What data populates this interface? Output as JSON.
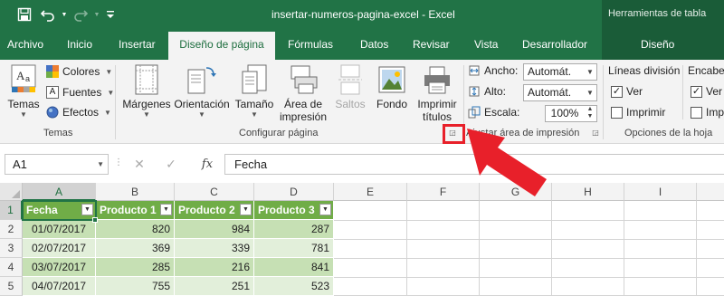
{
  "titlebar": {
    "document_title": "insertar-numeros-pagina-excel  -  Excel",
    "context_tools_label": "Herramientas de tabla"
  },
  "qat": {
    "save_icon": "save-icon",
    "undo_icon": "undo-icon",
    "redo_icon": "redo-icon",
    "customize_icon": "customize-qat-icon"
  },
  "tabs": {
    "archivo": "Archivo",
    "inicio": "Inicio",
    "insertar": "Insertar",
    "diseno_pagina": "Diseño de página",
    "formulas": "Fórmulas",
    "datos": "Datos",
    "revisar": "Revisar",
    "vista": "Vista",
    "desarrollador": "Desarrollador",
    "diseno": "Diseño"
  },
  "ribbon": {
    "temas": {
      "temas_label": "Temas",
      "colores_label": "Colores",
      "fuentes_label": "Fuentes",
      "efectos_label": "Efectos",
      "group_label": "Temas"
    },
    "configurar": {
      "margenes": "Márgenes",
      "orientacion": "Orientación",
      "tamano": "Tamaño",
      "area_impresion_1": "Área de",
      "area_impresion_2": "impresión",
      "saltos": "Saltos",
      "fondo": "Fondo",
      "imprimir_titulos_1": "Imprimir",
      "imprimir_titulos_2": "títulos",
      "group_label": "Configurar página"
    },
    "ajustar": {
      "ancho_label": "Ancho:",
      "ancho_value": "Automát.",
      "alto_label": "Alto:",
      "alto_value": "Automát.",
      "escala_label": "Escala:",
      "escala_value": "100%",
      "group_label": "Ajustar área de impresión"
    },
    "opciones": {
      "lineas_label": "Líneas división",
      "ver_label": "Ver",
      "imprimir_label": "Imprimir",
      "encabezados_label": "Encabeza",
      "ver2_label": "Ver",
      "imprimir2_label": "Imp",
      "group_label": "Opciones de la hoja"
    }
  },
  "formula_bar": {
    "name_box": "A1",
    "cancel_glyph": "✕",
    "enter_glyph": "✓",
    "fx_label": "fx",
    "formula": "Fecha"
  },
  "grid": {
    "columns": [
      "A",
      "B",
      "C",
      "D",
      "E",
      "F",
      "G",
      "H",
      "I"
    ],
    "rows": [
      "1",
      "2",
      "3",
      "4",
      "5"
    ],
    "header": [
      "Fecha",
      "Producto 1",
      "Producto 2",
      "Producto 3"
    ],
    "data": [
      [
        "01/07/2017",
        "820",
        "984",
        "287"
      ],
      [
        "02/07/2017",
        "369",
        "339",
        "781"
      ],
      [
        "03/07/2017",
        "285",
        "216",
        "841"
      ],
      [
        "04/07/2017",
        "755",
        "251",
        "523"
      ]
    ]
  },
  "colors": {
    "excel_green": "#217346",
    "table_header": "#70ad47",
    "band_dark": "#c6e0b4",
    "band_light": "#e2efda",
    "callout_red": "#e8202a"
  }
}
